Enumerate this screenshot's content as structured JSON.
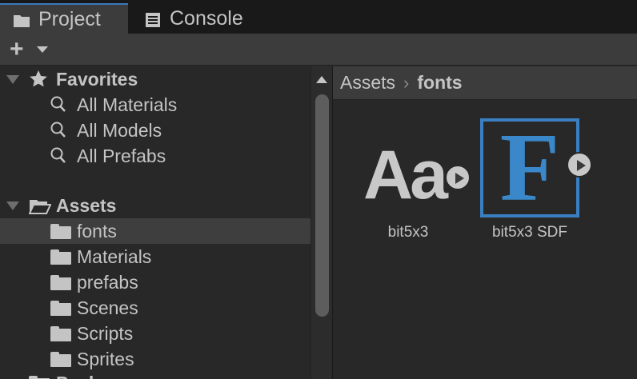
{
  "tabs": [
    {
      "label": "Project",
      "icon": "folder-icon",
      "active": true
    },
    {
      "label": "Console",
      "icon": "console-icon",
      "active": false
    }
  ],
  "toolbar": {
    "create_label": "+"
  },
  "tree": {
    "favorites": {
      "label": "Favorites",
      "items": [
        "All Materials",
        "All Models",
        "All Prefabs"
      ]
    },
    "assets": {
      "label": "Assets",
      "items": [
        "fonts",
        "Materials",
        "prefabs",
        "Scenes",
        "Scripts",
        "Sprites"
      ],
      "selected": "fonts"
    },
    "packages": {
      "label": "Packages"
    }
  },
  "breadcrumb": {
    "root": "Assets",
    "separator": "›",
    "current": "fonts"
  },
  "assets": [
    {
      "name": "bit5x3",
      "preview_text": "Aa",
      "type": "font"
    },
    {
      "name": "bit5x3 SDF",
      "preview_text": "F",
      "type": "sdf-font",
      "selected": true
    }
  ],
  "colors": {
    "accent": "#3a7fc1",
    "background": "#282828",
    "panel": "#3c3c3c"
  }
}
